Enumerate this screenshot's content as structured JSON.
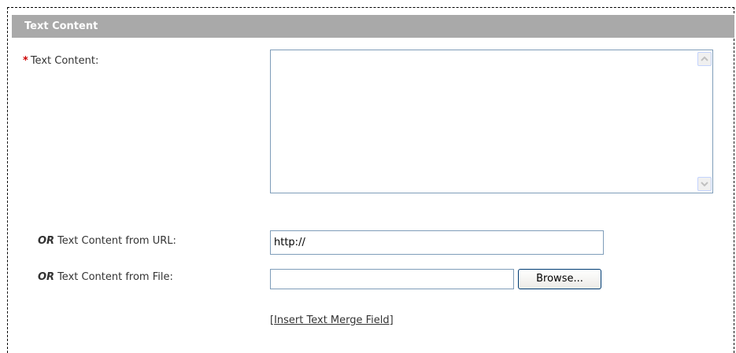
{
  "section": {
    "title": "Text Content"
  },
  "fields": {
    "text_content": {
      "required_marker": "*",
      "label": "Text Content:",
      "value": ""
    },
    "url": {
      "or_prefix": "OR",
      "label": "Text Content from URL:",
      "value": "http://"
    },
    "file": {
      "or_prefix": "OR",
      "label": "Text Content from File:",
      "value": "",
      "browse_label": "Browse..."
    }
  },
  "merge_field": {
    "open_bracket": "[",
    "link_text": "Insert Text Merge Field",
    "close_bracket": "]"
  },
  "icons": {
    "scroll_up": "scroll-up-arrow-icon",
    "scroll_down": "scroll-down-arrow-icon"
  },
  "colors": {
    "header_bg": "#a9a9a9",
    "header_text": "#ffffff",
    "required_star": "#cc0000",
    "input_border": "#7f9db9"
  }
}
